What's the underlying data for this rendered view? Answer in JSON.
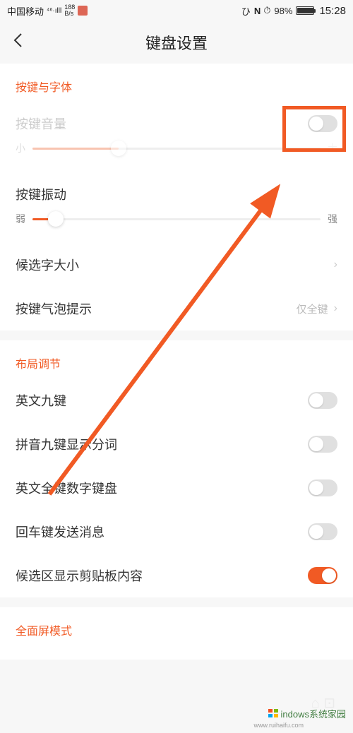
{
  "status": {
    "carrier": "中国移动",
    "signal": "⁴⁶·ılll",
    "speed_top": "188",
    "speed_unit": "B/s",
    "eye": "ひ",
    "nfc": "N",
    "alarm": "⏰",
    "battery_pct": "98%",
    "time": "15:28"
  },
  "nav": {
    "back": "‹",
    "title": "键盘设置"
  },
  "section1": {
    "header": "按键与字体"
  },
  "key_sound": {
    "label": "按键音量",
    "min": "小",
    "max": "大"
  },
  "key_vibrate": {
    "label": "按键振动",
    "min": "弱",
    "max": "强"
  },
  "candidate_size": {
    "label": "候选字大小"
  },
  "bubble": {
    "label": "按键气泡提示",
    "value": "仅全键"
  },
  "section2": {
    "header": "布局调节"
  },
  "layout_items": {
    "en9": "英文九键",
    "pinyin9": "拼音九键显示分词",
    "en_full_num": "英文全键数字键盘",
    "enter_send": "回车键发送消息",
    "clipboard": "候选区显示剪贴板内容"
  },
  "section3": {
    "header": "全面屏模式"
  },
  "watermark": {
    "text": "indows系统家园",
    "url": "www.ruihaifu.com"
  }
}
